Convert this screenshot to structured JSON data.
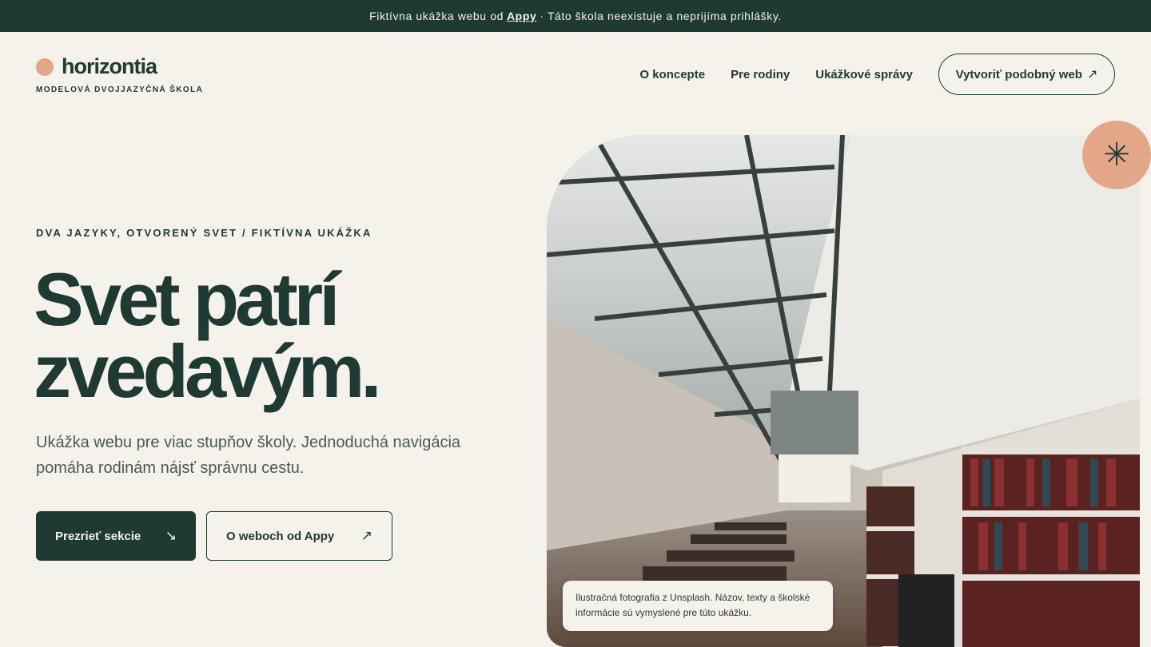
{
  "topbar": {
    "text_before": "Fiktívna ukážka webu od",
    "brand": "Appy",
    "text_after": "· Táto škola neexistuje a neprijíma prihlášky."
  },
  "logo": {
    "name": "horizontia",
    "tagline": "MODELOVÁ DVOJJAZYČNÁ ŠKOLA"
  },
  "nav": {
    "items": [
      "O koncepte",
      "Pre rodiny",
      "Ukážkové správy"
    ],
    "cta_label": "Vytvoriť podobný web",
    "cta_icon": "arrow-up-right-icon"
  },
  "hero": {
    "eyebrow": "DVA JAZYKY, OTVORENÝ SVET / FIKTÍVNA UKÁŽKA",
    "headline_line1": "Svet patrí",
    "headline_line2": "zvedavým.",
    "lede": "Ukážka webu pre viac stupňov školy. Jednoduchá navigácia pomáha rodinám nájsť správnu cestu.",
    "primary_button": "Prezrieť sekcie",
    "secondary_button": "O weboch od Appy"
  },
  "photo": {
    "caption": "Ilustračná fotografia z Unsplash. Názov, texty a školské informácie sú vymyslené pre túto ukážku.",
    "badge_icon": "asterisk-icon"
  },
  "colors": {
    "background": "#f4f2ea",
    "primary": "#1f3a32",
    "accent": "#e3a688"
  }
}
